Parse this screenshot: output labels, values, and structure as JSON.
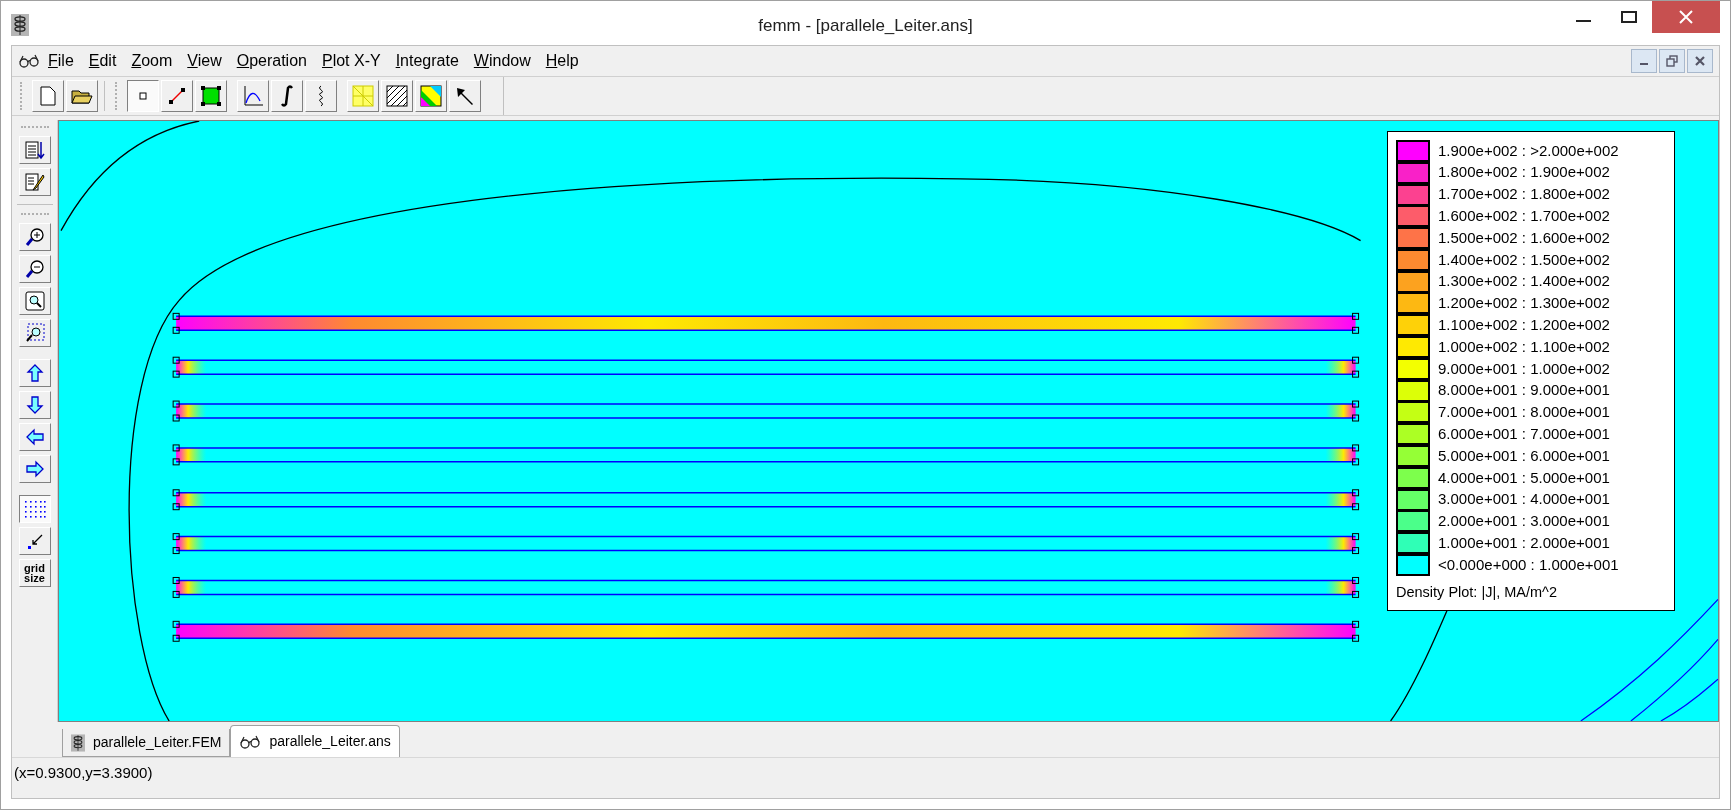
{
  "window": {
    "title": "femm - [parallele_Leiter.ans]"
  },
  "menu": [
    "File",
    "Edit",
    "Zoom",
    "View",
    "Operation",
    "Plot X-Y",
    "Integrate",
    "Window",
    "Help"
  ],
  "draw_modes": [
    {
      "kind": "node",
      "selected": true
    },
    {
      "kind": "segment",
      "selected": false
    },
    {
      "kind": "block",
      "selected": false
    }
  ],
  "left_toolbar": {
    "show_grid": true,
    "grid_size_button": "grid size"
  },
  "legend": {
    "entries": [
      {
        "label": "1.900e+002 : >2.000e+002",
        "color": "#ff00ff"
      },
      {
        "label": "1.800e+002 : 1.900e+002",
        "color": "#f921c8"
      },
      {
        "label": "1.700e+002 : 1.800e+002",
        "color": "#fc4190"
      },
      {
        "label": "1.600e+002 : 1.700e+002",
        "color": "#fd5c6a"
      },
      {
        "label": "1.500e+002 : 1.600e+002",
        "color": "#fe7348"
      },
      {
        "label": "1.400e+002 : 1.500e+002",
        "color": "#fd8a30"
      },
      {
        "label": "1.300e+002 : 1.400e+002",
        "color": "#fca21f"
      },
      {
        "label": "1.200e+002 : 1.300e+002",
        "color": "#fdb812"
      },
      {
        "label": "1.100e+002 : 1.200e+002",
        "color": "#fed108"
      },
      {
        "label": "1.000e+002 : 1.100e+002",
        "color": "#fee902"
      },
      {
        "label": "9.000e+001 : 1.000e+002",
        "color": "#f3ff00"
      },
      {
        "label": "8.000e+001 : 9.000e+001",
        "color": "#dcff07"
      },
      {
        "label": "7.000e+001 : 8.000e+001",
        "color": "#c4ff14"
      },
      {
        "label": "6.000e+001 : 7.000e+001",
        "color": "#acff24"
      },
      {
        "label": "5.000e+001 : 6.000e+001",
        "color": "#95ff36"
      },
      {
        "label": "4.000e+001 : 5.000e+001",
        "color": "#7dff4c"
      },
      {
        "label": "3.000e+001 : 4.000e+001",
        "color": "#65ff67"
      },
      {
        "label": "2.000e+001 : 3.000e+001",
        "color": "#4bff8a"
      },
      {
        "label": "1.000e+001 : 2.000e+001",
        "color": "#2fffb6"
      },
      {
        "label": "<0.000e+000 : 1.000e+001",
        "color": "#00ffff"
      }
    ],
    "title": "Density Plot: |J|, MA/m^2"
  },
  "tabs": [
    {
      "label": "parallele_Leiter.FEM",
      "kind": "fem",
      "selected": false
    },
    {
      "label": "parallele_Leiter.ans",
      "kind": "ans",
      "selected": true
    }
  ],
  "status_bar": "(x=0.9300,y=3.3900)"
}
